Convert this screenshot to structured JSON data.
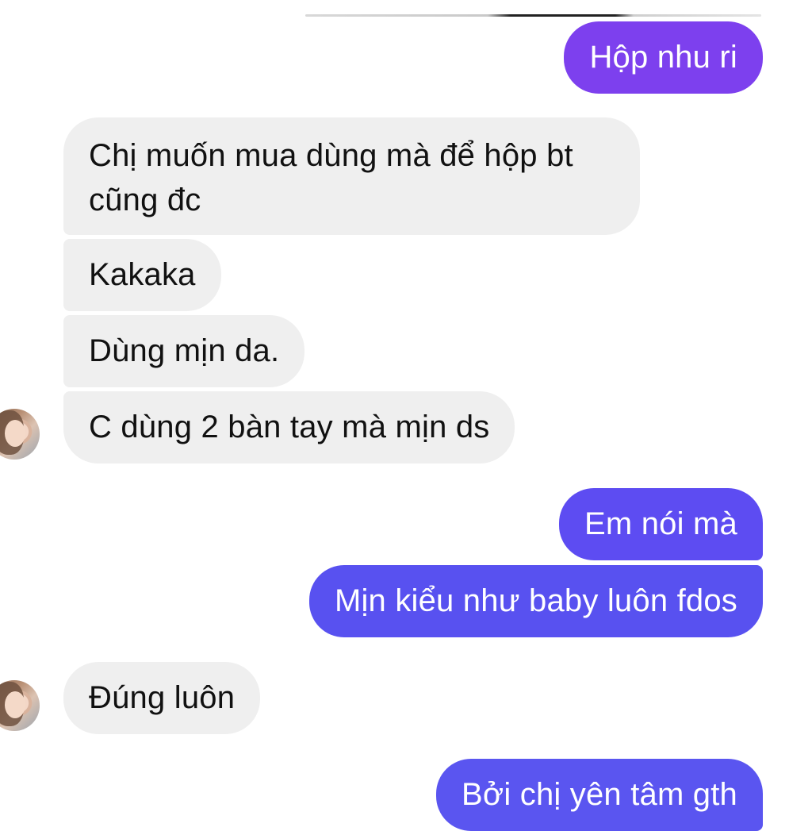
{
  "conversation": {
    "messages": [
      {
        "sender": "me",
        "text": "Hộp nhu ri"
      },
      {
        "sender": "contact",
        "text": "Chị muốn mua dùng mà để hộp bt cũng đc"
      },
      {
        "sender": "contact",
        "text": "Kakaka"
      },
      {
        "sender": "contact",
        "text": "Dùng mịn da."
      },
      {
        "sender": "contact",
        "text": "C dùng 2 bàn tay mà mịn ds"
      },
      {
        "sender": "me",
        "text": "Em nói mà"
      },
      {
        "sender": "me",
        "text": "Mịn kiểu như baby luôn fdos"
      },
      {
        "sender": "contact",
        "text": "Đúng luôn"
      },
      {
        "sender": "me",
        "text": "Bởi chị yên tâm gth"
      }
    ]
  },
  "colors": {
    "incoming_bubble": "#efefef",
    "outgoing_bubble_top": "#7d40ee",
    "outgoing_bubble_bottom": "#5a55f0",
    "incoming_text": "#111111",
    "outgoing_text": "#ffffff"
  }
}
